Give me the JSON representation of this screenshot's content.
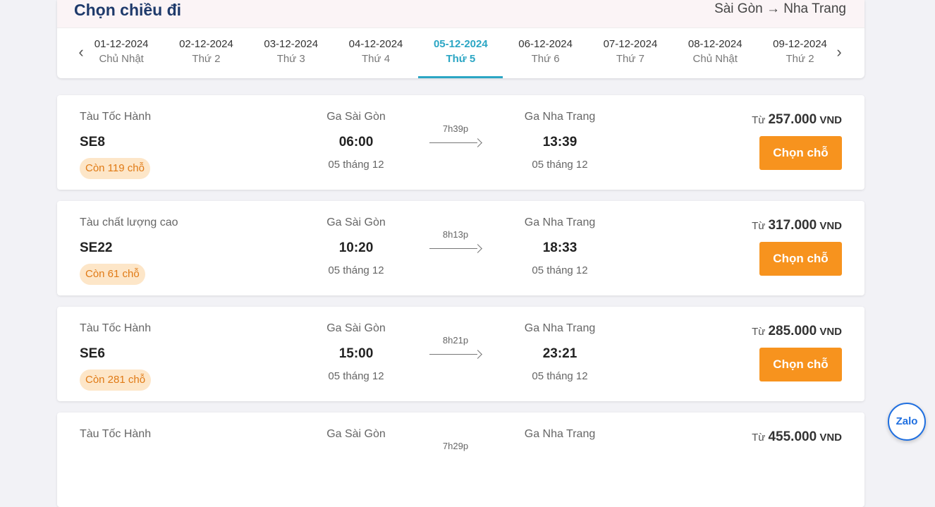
{
  "header": {
    "title": "Chọn chiều đi",
    "route": "Sài Gòn → Nha Trang",
    "prev_icon": "chevron-left",
    "next_icon": "chevron-right"
  },
  "dates": [
    {
      "date": "01-12-2024",
      "weekday": "Chủ Nhật",
      "active": false
    },
    {
      "date": "02-12-2024",
      "weekday": "Thứ 2",
      "active": false
    },
    {
      "date": "03-12-2024",
      "weekday": "Thứ 3",
      "active": false
    },
    {
      "date": "04-12-2024",
      "weekday": "Thứ 4",
      "active": false
    },
    {
      "date": "05-12-2024",
      "weekday": "Thứ 5",
      "active": true
    },
    {
      "date": "06-12-2024",
      "weekday": "Thứ 6",
      "active": false
    },
    {
      "date": "07-12-2024",
      "weekday": "Thứ 7",
      "active": false
    },
    {
      "date": "08-12-2024",
      "weekday": "Chủ Nhật",
      "active": false
    },
    {
      "date": "09-12-2024",
      "weekday": "Thứ 2",
      "active": false
    }
  ],
  "trains": [
    {
      "type": "Tàu Tốc Hành",
      "code": "SE8",
      "seats": "Còn 119 chỗ",
      "from_station": "Ga Sài Gòn",
      "depart_time": "06:00",
      "depart_day": "05 tháng 12",
      "duration": "7h39p",
      "to_station": "Ga Nha Trang",
      "arrive_time": "13:39",
      "arrive_day": "05 tháng 12",
      "price_prefix": "Từ",
      "price": "257.000",
      "currency": "VND",
      "button": "Chọn chỗ"
    },
    {
      "type": "Tàu chất lượng cao",
      "code": "SE22",
      "seats": "Còn 61 chỗ",
      "from_station": "Ga Sài Gòn",
      "depart_time": "10:20",
      "depart_day": "05 tháng 12",
      "duration": "8h13p",
      "to_station": "Ga Nha Trang",
      "arrive_time": "18:33",
      "arrive_day": "05 tháng 12",
      "price_prefix": "Từ",
      "price": "317.000",
      "currency": "VND",
      "button": "Chọn chỗ"
    },
    {
      "type": "Tàu Tốc Hành",
      "code": "SE6",
      "seats": "Còn 281 chỗ",
      "from_station": "Ga Sài Gòn",
      "depart_time": "15:00",
      "depart_day": "05 tháng 12",
      "duration": "8h21p",
      "to_station": "Ga Nha Trang",
      "arrive_time": "23:21",
      "arrive_day": "05 tháng 12",
      "price_prefix": "Từ",
      "price": "285.000",
      "currency": "VND",
      "button": "Chọn chỗ"
    },
    {
      "type": "Tàu Tốc Hành",
      "code": "",
      "seats": "",
      "from_station": "Ga Sài Gòn",
      "depart_time": "",
      "depart_day": "",
      "duration": "7h29p",
      "to_station": "Ga Nha Trang",
      "arrive_time": "",
      "arrive_day": "",
      "price_prefix": "Từ",
      "price": "455.000",
      "currency": "VND",
      "button": ""
    }
  ],
  "zalo": {
    "label": "Zalo"
  },
  "colors": {
    "accent": "#2ba6c4",
    "button": "#f7931e",
    "seat_badge_bg": "#fde6c8",
    "title": "#1e3a6b"
  }
}
